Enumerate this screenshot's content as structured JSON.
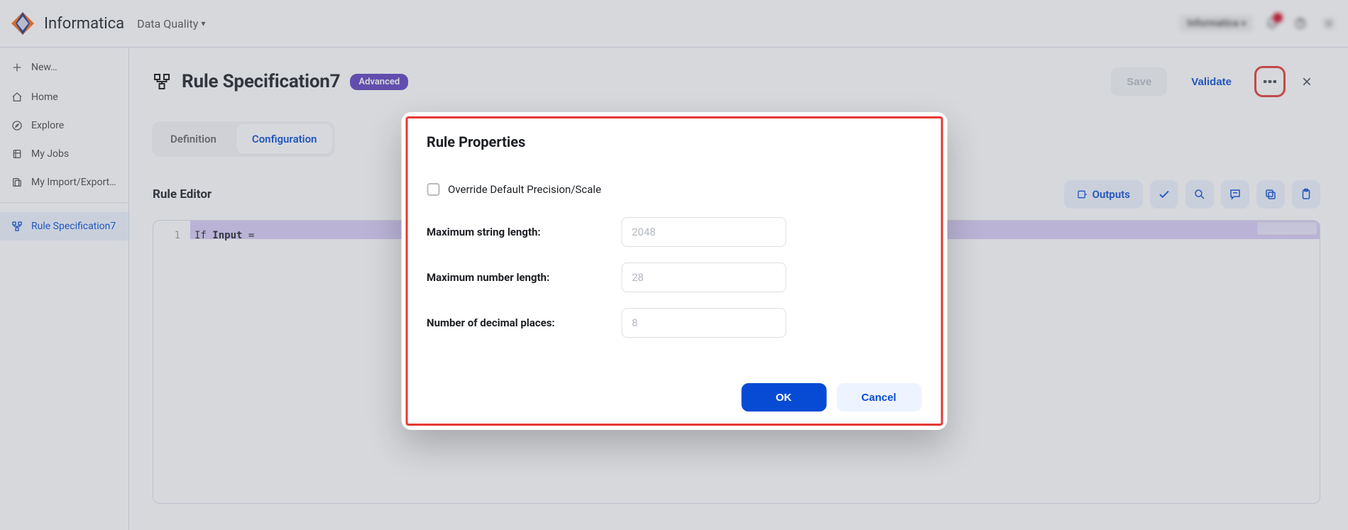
{
  "brand": {
    "wordmark": "Informatica",
    "app_name": "Data Quality"
  },
  "header": {
    "user_label": "Informatica"
  },
  "sidebar": {
    "new_label": "New…",
    "home": "Home",
    "explore": "Explore",
    "my_jobs": "My Jobs",
    "import_export": "My Import/Export…",
    "current_item": "Rule Specification7"
  },
  "page": {
    "title": "Rule Specification7",
    "badge": "Advanced",
    "save": "Save",
    "validate": "Validate"
  },
  "tabs": {
    "definition": "Definition",
    "configuration": "Configuration"
  },
  "editor": {
    "title": "Rule Editor",
    "outputs": "Outputs",
    "line_number": "1",
    "kw_if": "If",
    "identifier": "Input",
    "eq": "="
  },
  "dialog": {
    "title": "Rule Properties",
    "override_label": "Override Default Precision/Scale",
    "max_string_label": "Maximum string length:",
    "max_string_placeholder": "2048",
    "max_number_label": "Maximum number length:",
    "max_number_placeholder": "28",
    "decimal_label": "Number of decimal places:",
    "decimal_placeholder": "8",
    "ok": "OK",
    "cancel": "Cancel"
  }
}
